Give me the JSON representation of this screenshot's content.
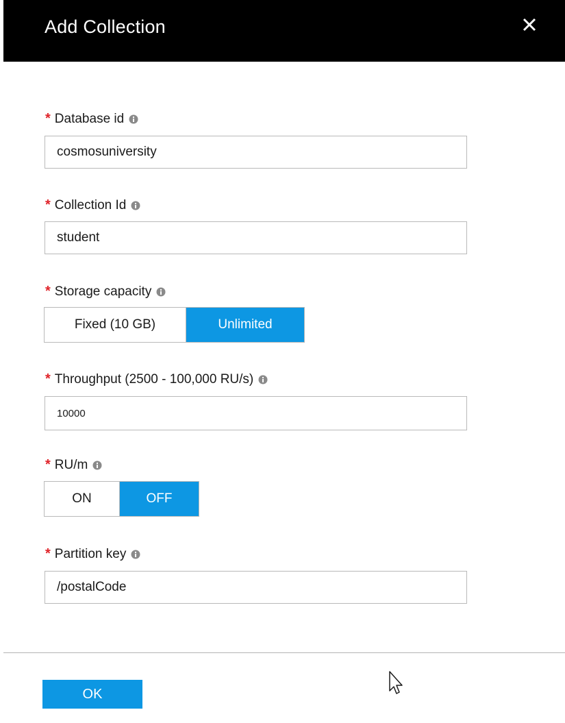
{
  "dialog": {
    "title": "Add Collection"
  },
  "fields": {
    "database_id": {
      "required_mark": "*",
      "label": "Database id",
      "value": "cosmosuniversity"
    },
    "collection_id": {
      "required_mark": "*",
      "label": "Collection Id",
      "value": "student"
    },
    "storage_capacity": {
      "required_mark": "*",
      "label": "Storage capacity",
      "options": [
        "Fixed (10 GB)",
        "Unlimited"
      ],
      "selected": "Unlimited"
    },
    "throughput": {
      "required_mark": "*",
      "label": "Throughput (2500 - 100,000 RU/s)",
      "value": "10000"
    },
    "ru_per_minute": {
      "required_mark": "*",
      "label": "RU/m",
      "options": [
        "ON",
        "OFF"
      ],
      "selected": "OFF"
    },
    "partition_key": {
      "required_mark": "*",
      "label": "Partition key",
      "value": "/postalCode"
    }
  },
  "footer": {
    "ok_label": "OK"
  },
  "icons": {
    "close": "close-icon",
    "info": "info-icon",
    "cursor": "mouse-pointer-icon"
  },
  "colors": {
    "header_bg": "#000000",
    "accent": "#0d97e3",
    "required": "#e0242a",
    "border": "#b9b9b9"
  }
}
